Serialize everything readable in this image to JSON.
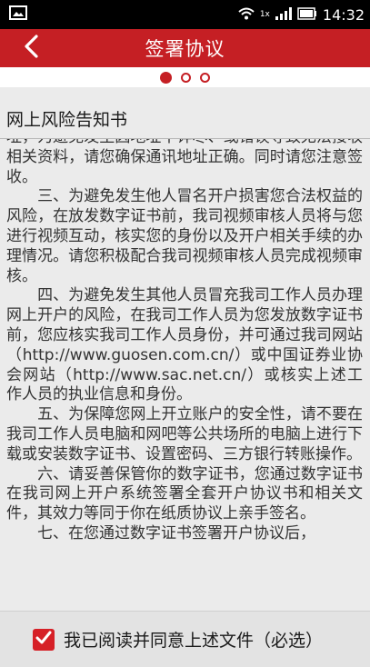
{
  "statusbar": {
    "time": "14:32",
    "network": "1x",
    "icons": [
      "notification-image-icon",
      "wifi-icon",
      "signal-icon",
      "battery-icon"
    ]
  },
  "header": {
    "title": "签署协议",
    "back_icon": "chevron-left-icon"
  },
  "pager": {
    "count": 3,
    "active": 0
  },
  "section": {
    "title": "网上风险告知书"
  },
  "content": {
    "paragraphs": [
      "址，为避免发生因地址不详尽、或错误导致无法接收相关资料，请您确保通讯地址正确。同时请您注意签收。",
      "　　三、为避免发生他人冒名开户损害您合法权益的风险，在放发数字证书前，我司视频审核人员将与您进行视频互动，核实您的身份以及开户相关手续的办理情况。请您积极配合我司视频审核人员完成视频审核。",
      "　　四、为避免发生其他人员冒充我司工作人员办理网上开户的风险，在我司工作人员为您发放数字证书前，您应核实我司工作人员身份，并可通过我司网站（http://www.guosen.com.cn/）或中国证券业协会网站（http://www.sac.net.cn/）或核实上述工作人员的执业信息和身份。",
      "　　五、为保障您网上开立账户的安全性，请不要在我司工作人员电脑和网吧等公共场所的电脑上进行下载或安装数字证书、设置密码、三方银行转账操作。",
      "　　六、请妥善保管你的数字证书，您通过数字证书在我司网上开户系统签署全套开户协议书和相关文件，其效力等同于你在纸质协议上亲手签名。",
      "　　七、在您通过数字证书签署开户协议后，"
    ]
  },
  "footer": {
    "agree_label": "我已阅读并同意上述文件（必选）",
    "checked": true
  },
  "colors": {
    "accent": "#c51f24",
    "checkbox": "#d62027"
  }
}
